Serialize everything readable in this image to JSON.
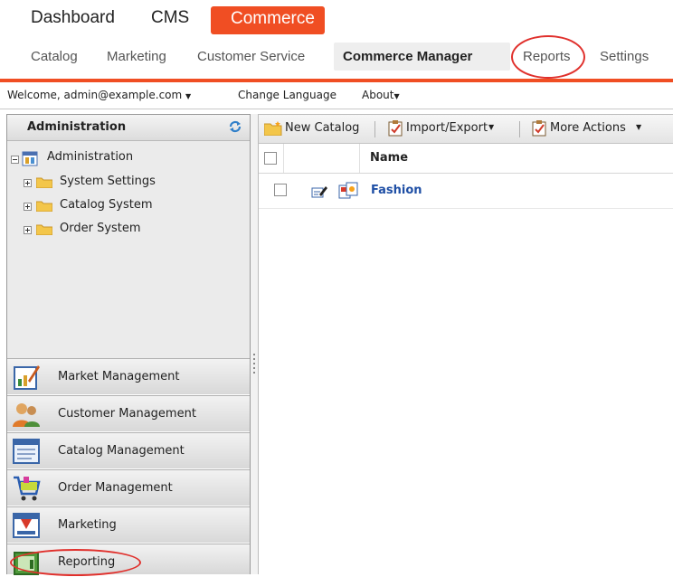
{
  "top_nav": {
    "dashboard": "Dashboard",
    "cms": "CMS",
    "commerce": "Commerce",
    "commerce_color": "#f04e23"
  },
  "sub_nav": {
    "catalog": "Catalog",
    "marketing": "Marketing",
    "customer_service": "Customer Service",
    "commerce_manager": "Commerce Manager",
    "reports": "Reports",
    "settings": "Settings"
  },
  "welcome_bar": {
    "welcome": "Welcome, admin@example.com",
    "change_language": "Change Language",
    "about": "About"
  },
  "left_panel": {
    "title": "Administration",
    "tree": {
      "root": "Administration",
      "children": [
        "System Settings",
        "Catalog System",
        "Order System"
      ]
    },
    "accordion": [
      {
        "label": "Market Management",
        "icon": "market-management-icon"
      },
      {
        "label": "Customer Management",
        "icon": "customer-management-icon"
      },
      {
        "label": "Catalog Management",
        "icon": "catalog-management-icon"
      },
      {
        "label": "Order Management",
        "icon": "shopping-cart-icon"
      },
      {
        "label": "Marketing",
        "icon": "marketing-icon"
      },
      {
        "label": "Reporting",
        "icon": "reporting-icon"
      }
    ]
  },
  "toolbar": {
    "new_catalog": "New Catalog",
    "import_export": "Import/Export",
    "more_actions": "More Actions"
  },
  "grid": {
    "columns": [
      "Name"
    ],
    "rows": [
      {
        "name": "Fashion"
      }
    ]
  },
  "highlight_color": "#e0302c"
}
